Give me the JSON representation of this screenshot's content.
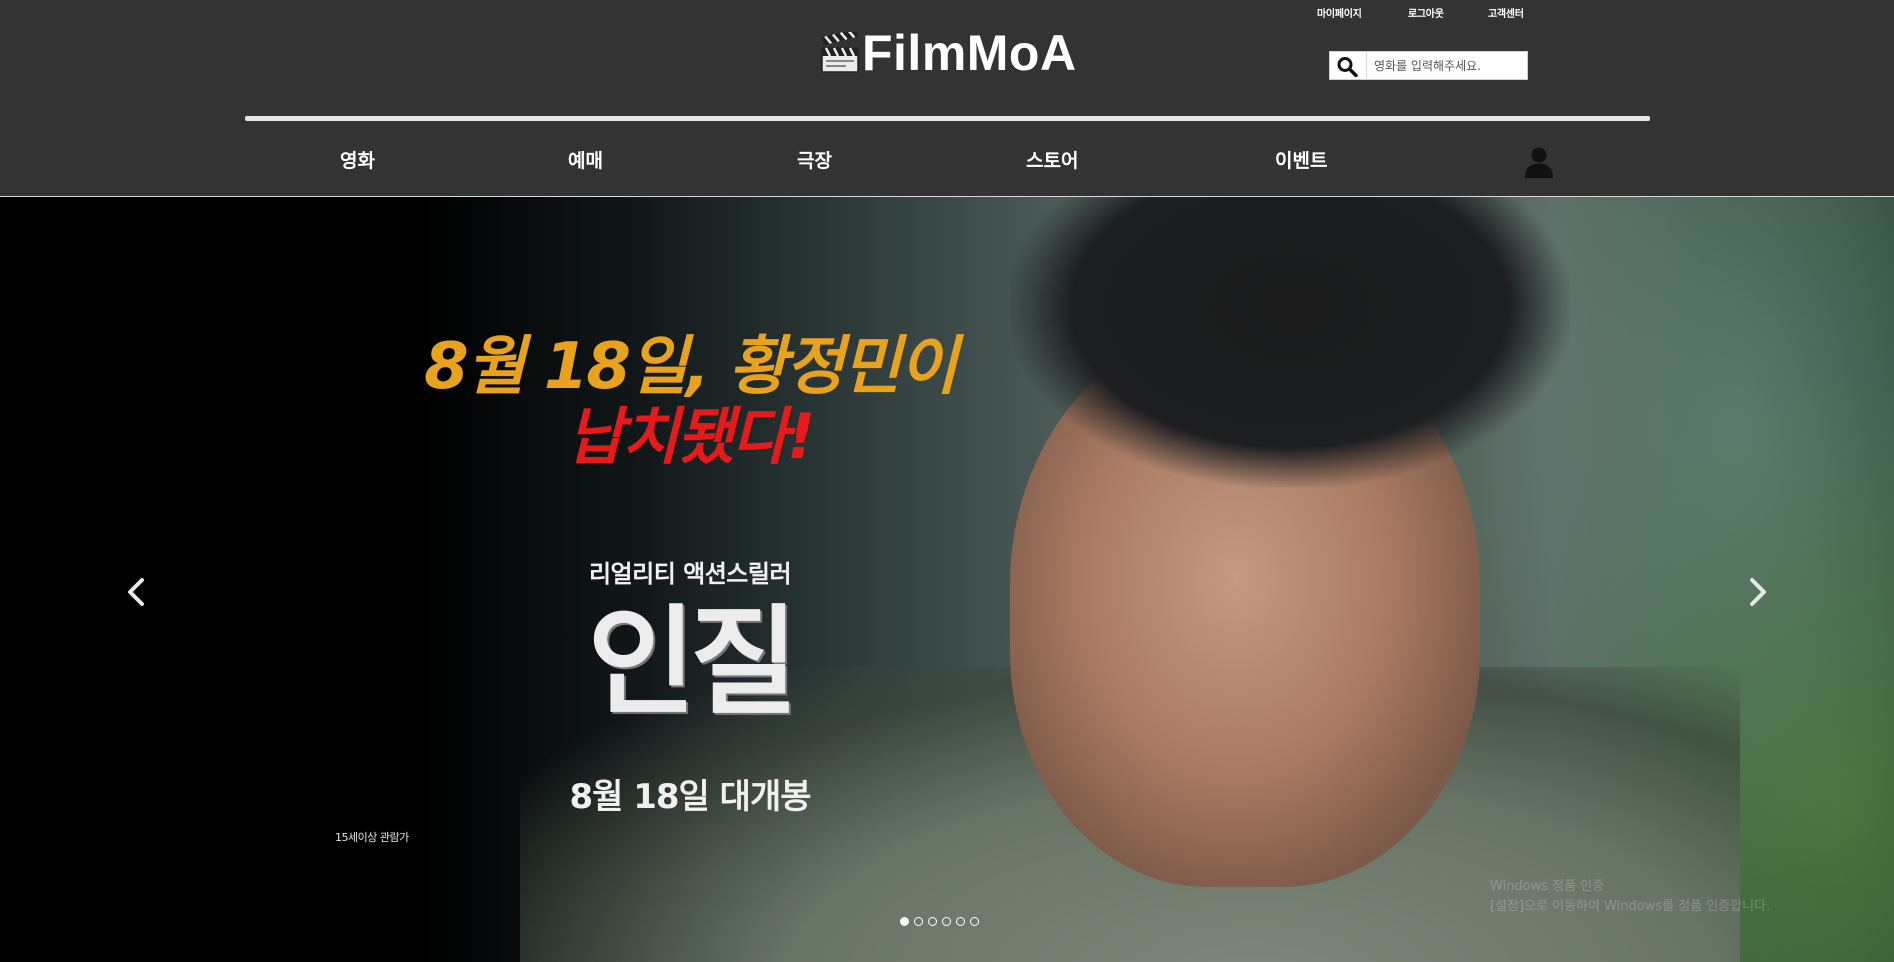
{
  "header": {
    "top_links": [
      "마이페이지",
      "로그아웃",
      "고객센터"
    ],
    "logo_text": "FilmMoA",
    "search": {
      "placeholder": "영화를 입력해주세요."
    },
    "nav": [
      "영화",
      "예매",
      "극장",
      "스토어",
      "이벤트"
    ]
  },
  "banner": {
    "headline_line1": "8월 18일, 황정민이",
    "headline_line2": "납치됐다!",
    "genre": "리얼리티 액션스릴러",
    "title": "인질",
    "release": "8월 18일 대개봉",
    "rating": "15세이상 관람가",
    "slide_count": 6,
    "active_slide": 1
  },
  "watermark": {
    "line1": "Windows 정품 인증",
    "line2": "[설정]으로 이동하여 Windows를 정품 인증합니다."
  },
  "colors": {
    "header_bg": "#333333",
    "headline_orange": "#e8a21e",
    "headline_red": "#e51b1b"
  },
  "icons": [
    "clapperboard-icon",
    "search-icon",
    "user-icon",
    "chevron-left-icon",
    "chevron-right-icon"
  ]
}
